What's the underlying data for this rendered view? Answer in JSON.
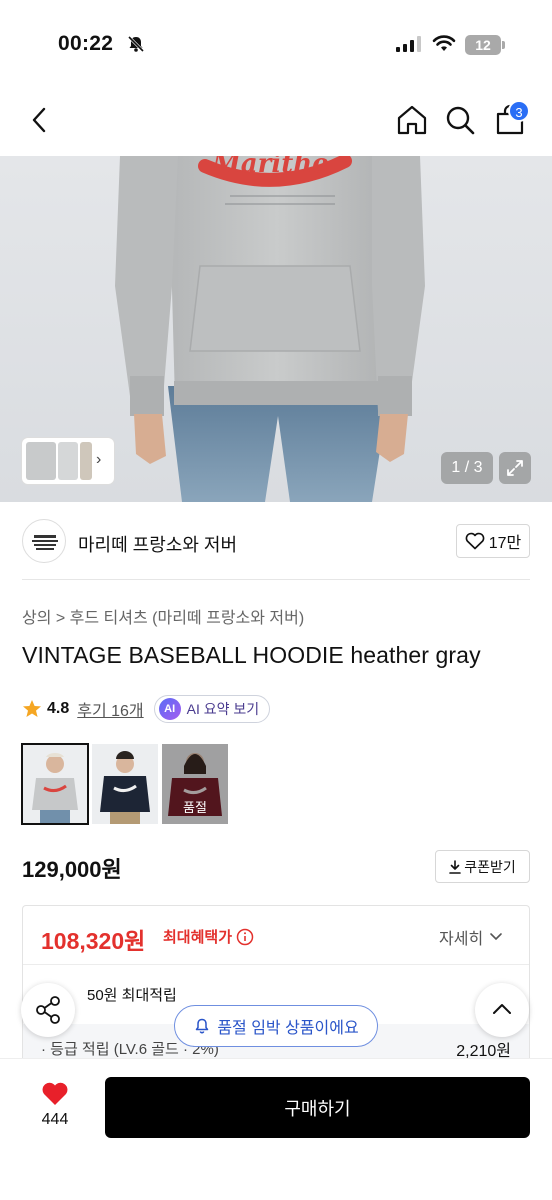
{
  "status_bar": {
    "time": "00:22",
    "battery": "12"
  },
  "nav": {
    "cart_count": "3"
  },
  "gallery": {
    "counter": "1 / 3"
  },
  "brand": {
    "name": "마리떼 프랑소와 저버",
    "likes": "17만"
  },
  "product": {
    "breadcrumb": "상의 > 후드 티셔츠 (마리떼 프랑소와 저버)",
    "title": "VINTAGE BASEBALL HOODIE heather gray",
    "rating": "4.8",
    "review_link": "후기 16개",
    "ai_summary": "AI 요약 보기",
    "ai_badge": "AI",
    "soldout_label": "품절",
    "price": "129,000원",
    "coupon_label": "쿠폰받기"
  },
  "benefit": {
    "max_price": "108,320원",
    "max_label": "최대혜택가",
    "detail_label": "자세히",
    "points": "50원 최대적립",
    "grade_label": "· 등급 적립 (LV.6 골드 · 2%)",
    "grade_value": "2,210원"
  },
  "toast": {
    "label": "품절 임박 상품이에요"
  },
  "bottom": {
    "like_count": "444",
    "buy_label": "구매하기"
  },
  "colors": {
    "accent_red": "#e3312d",
    "badge_blue": "#2a6ef5",
    "toast_blue": "#2a55c9"
  }
}
